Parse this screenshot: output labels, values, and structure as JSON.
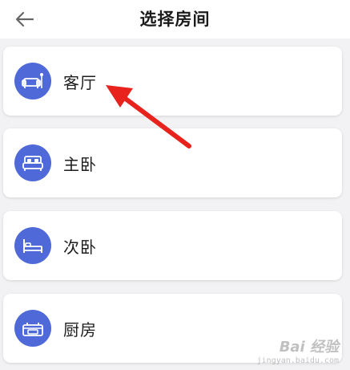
{
  "header": {
    "title": "选择房间",
    "back_icon": "arrow-left-icon"
  },
  "rooms": [
    {
      "label": "客厅",
      "icon": "sofa-icon"
    },
    {
      "label": "主卧",
      "icon": "double-bed-icon"
    },
    {
      "label": "次卧",
      "icon": "single-bed-icon"
    },
    {
      "label": "厨房",
      "icon": "stove-icon"
    }
  ],
  "watermark": {
    "text": "Bai 经验",
    "url_text": "jingyan.baidu.com"
  },
  "colors": {
    "accent": "#4f6ad8",
    "annotation_arrow": "#e8221d",
    "background": "#f2f2f4"
  }
}
